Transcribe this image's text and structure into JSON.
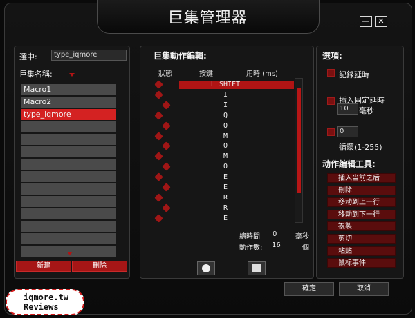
{
  "window": {
    "title": "巨集管理器",
    "minimize_label": "—",
    "close_label": "✕"
  },
  "left": {
    "selected_label": "選中:",
    "selected_value": "type_iqmore",
    "macro_name_label": "巨集名稱:",
    "macros": [
      "Macro1",
      "Macro2",
      "type_iqmore",
      "",
      "",
      "",
      "",
      "",
      "",
      "",
      "",
      "",
      "",
      ""
    ],
    "new_button": "新建",
    "delete_button": "刪除"
  },
  "editor": {
    "title": "巨集動作編輯:",
    "col_status": "狀態",
    "col_key": "按鍵",
    "col_time": "用時 (ms)",
    "events": [
      {
        "key": "L SHIFT",
        "type": "down"
      },
      {
        "key": "I",
        "type": "down"
      },
      {
        "key": "I",
        "type": "up"
      },
      {
        "key": "Q",
        "type": "down"
      },
      {
        "key": "Q",
        "type": "up"
      },
      {
        "key": "M",
        "type": "down"
      },
      {
        "key": "O",
        "type": "up"
      },
      {
        "key": "M",
        "type": "down"
      },
      {
        "key": "O",
        "type": "up"
      },
      {
        "key": "E",
        "type": "down"
      },
      {
        "key": "E",
        "type": "up"
      },
      {
        "key": "R",
        "type": "down"
      },
      {
        "key": "R",
        "type": "up"
      },
      {
        "key": "E",
        "type": "down"
      }
    ],
    "total_time_label": "總時間",
    "total_time_value": "0",
    "total_time_unit": "毫秒",
    "count_label": "動作數:",
    "count_value": "16",
    "count_unit": "個"
  },
  "options": {
    "title": "選項:",
    "record_delay": "記錄延時",
    "insert_fixed_delay": "插入固定延時",
    "fixed_delay_value": "10",
    "fixed_delay_unit": "毫秒",
    "loop_value": "0",
    "loop_label": "循環(1-255)",
    "tools_title": "动作编辑工具:",
    "tools": [
      "插入当前之后",
      "刪除",
      "移动到上一行",
      "移动到下一行",
      "複製",
      "剪切",
      "粘贴",
      "鼠标事件"
    ]
  },
  "footer": {
    "ok": "確定",
    "cancel": "取消"
  },
  "watermark": {
    "line1": "iqmore.tw",
    "line2": "Reviews"
  }
}
